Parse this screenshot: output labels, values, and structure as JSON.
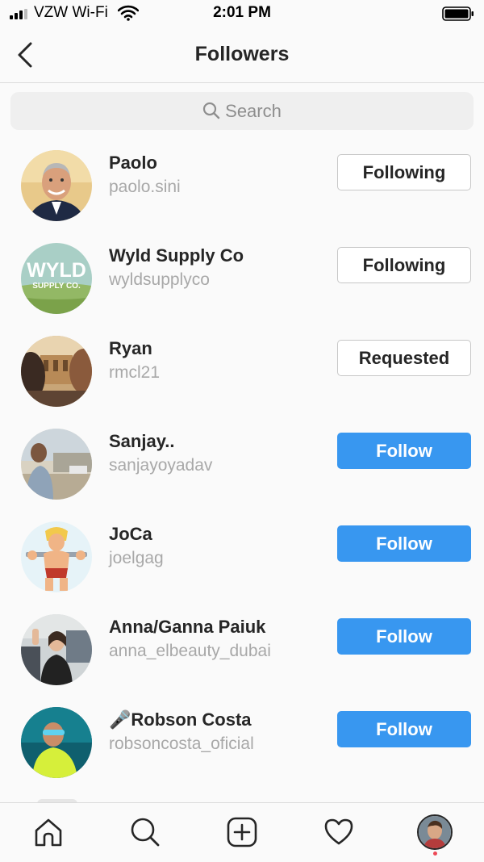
{
  "status_bar": {
    "carrier": "VZW Wi-Fi",
    "time": "2:01 PM"
  },
  "nav": {
    "title": "Followers",
    "back_icon": "chevron-left-icon"
  },
  "search": {
    "placeholder": "Search",
    "icon": "search-icon"
  },
  "followers": [
    {
      "name": "Paolo",
      "handle": "paolo.sini",
      "button": "Following",
      "button_style": "outline"
    },
    {
      "name": "Wyld Supply Co",
      "handle": "wyldsupplyco",
      "button": "Following",
      "button_style": "outline",
      "avatar_text_1": "WYLD",
      "avatar_text_2": "SUPPLY CO."
    },
    {
      "name": "Ryan",
      "handle": "rmcl21",
      "button": "Requested",
      "button_style": "outline"
    },
    {
      "name": "Sanjay..",
      "handle": "sanjayoyadav",
      "button": "Follow",
      "button_style": "fill"
    },
    {
      "name": "JoCa",
      "handle": "joelgag",
      "button": "Follow",
      "button_style": "fill"
    },
    {
      "name": "Anna/Ganna Paiuk",
      "handle": "anna_elbeauty_dubai",
      "button": "Follow",
      "button_style": "fill"
    },
    {
      "name": "🎤Robson Costa",
      "handle": "robsoncosta_oficial",
      "button": "Follow",
      "button_style": "fill"
    }
  ],
  "tab_bar": {
    "icons": [
      "home-icon",
      "search-icon",
      "add-post-icon",
      "activity-heart-icon",
      "profile-avatar"
    ]
  },
  "colors": {
    "follow_blue": "#3897f0",
    "notification_dot": "#ed4956"
  }
}
